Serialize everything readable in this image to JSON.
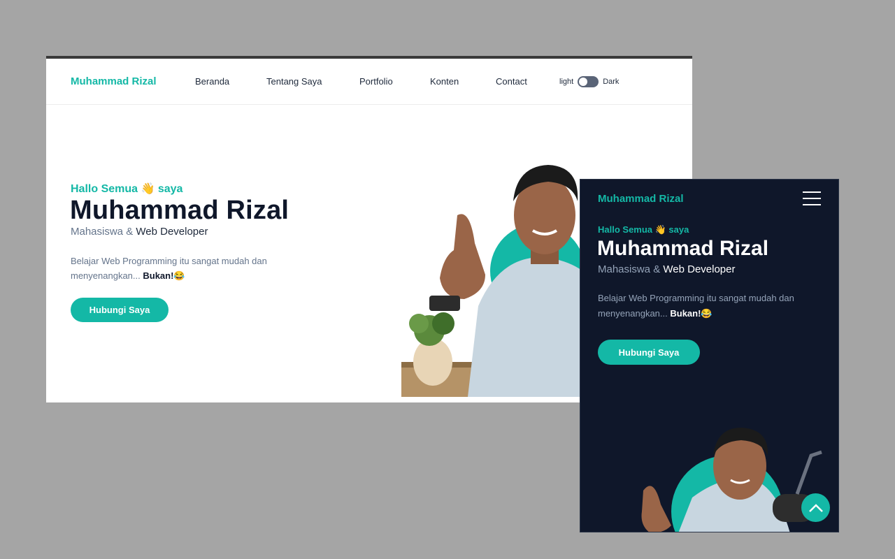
{
  "desktop": {
    "brand": "Muhammad Rizal",
    "nav": [
      "Beranda",
      "Tentang Saya",
      "Portfolio",
      "Konten",
      "Contact"
    ],
    "toggle": {
      "light_label": "light",
      "dark_label": "Dark"
    },
    "hero": {
      "greeting": "Hallo Semua 👋 saya",
      "name": "Muhammad Rizal",
      "role_prefix": "Mahasiswa & ",
      "role_main": "Web Developer",
      "desc": "Belajar Web Programming itu sangat mudah dan menyenangkan... ",
      "desc_bold": "Bukan!",
      "desc_emoji": "😂",
      "cta": "Hubungi Saya"
    }
  },
  "mobile": {
    "brand": "Muhammad Rizal",
    "hero": {
      "greeting": "Hallo Semua 👋 saya",
      "name": "Muhammad Rizal",
      "role_prefix": "Mahasiswa & ",
      "role_main": "Web Developer",
      "desc": "Belajar Web Programming itu sangat mudah dan menyenangkan... ",
      "desc_bold": "Bukan!",
      "desc_emoji": "😂",
      "cta": "Hubungi Saya"
    }
  },
  "colors": {
    "accent": "#14b8a6",
    "dark_bg": "#0f172a",
    "text_dark": "#0f172a",
    "muted": "#64748b"
  },
  "icons": [
    "hamburger-menu-icon",
    "chevron-up-icon",
    "waving-hand-emoji",
    "laughing-emoji"
  ]
}
